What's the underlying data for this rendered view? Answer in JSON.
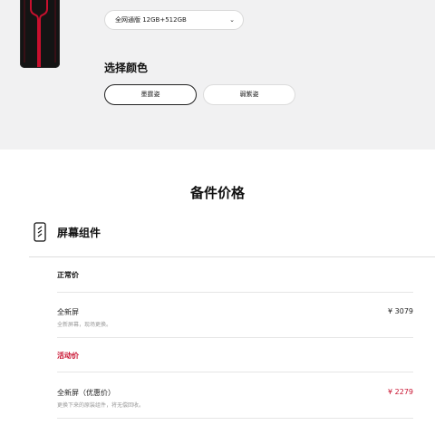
{
  "product": {
    "variant_value": "全网通版 12GB+512GB",
    "variant_chevron": "⌄"
  },
  "color_section": {
    "title": "选择颜色",
    "options": [
      {
        "label": "墨霆姿",
        "selected": true
      },
      {
        "label": "弱紫姿",
        "selected": false
      }
    ]
  },
  "parts_price": {
    "title": "备件价格",
    "component": {
      "icon": "phone-screen-icon",
      "title": "屏幕组件"
    },
    "groups": [
      {
        "label": "正常价",
        "color": "#111111",
        "items": [
          {
            "name": "全新屏",
            "desc": "全新屏幕，现场更换。",
            "price": "¥ 3079"
          }
        ]
      },
      {
        "label": "活动价",
        "color": "#c8102e",
        "items": [
          {
            "name": "全新屏（优惠价）",
            "desc": "更换下来的原装组件，将无偿回收。",
            "price": "¥ 2279"
          }
        ]
      }
    ]
  },
  "colors": {
    "accent_red": "#c8102e",
    "top_bg": "#f1f1f2"
  }
}
